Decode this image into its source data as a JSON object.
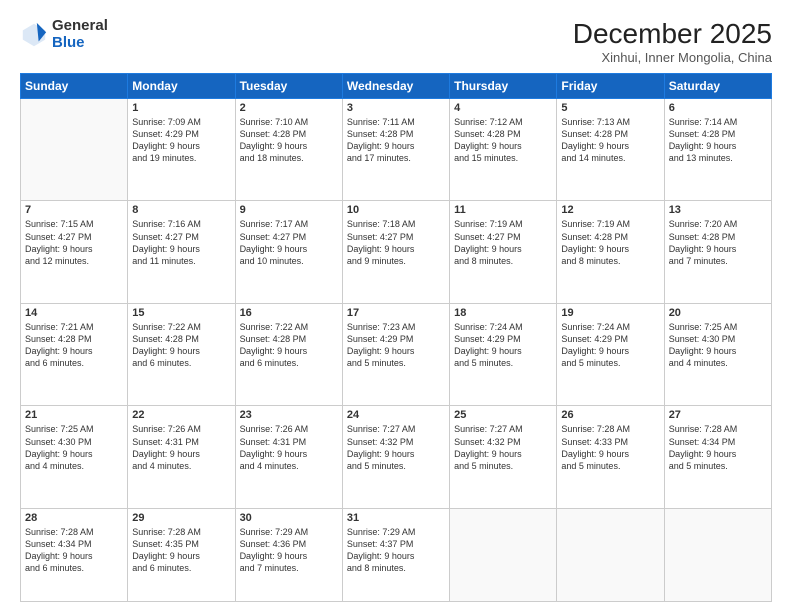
{
  "logo": {
    "general": "General",
    "blue": "Blue"
  },
  "header": {
    "month": "December 2025",
    "location": "Xinhui, Inner Mongolia, China"
  },
  "weekdays": [
    "Sunday",
    "Monday",
    "Tuesday",
    "Wednesday",
    "Thursday",
    "Friday",
    "Saturday"
  ],
  "weeks": [
    [
      {
        "day": "",
        "info": ""
      },
      {
        "day": "1",
        "info": "Sunrise: 7:09 AM\nSunset: 4:29 PM\nDaylight: 9 hours\nand 19 minutes."
      },
      {
        "day": "2",
        "info": "Sunrise: 7:10 AM\nSunset: 4:28 PM\nDaylight: 9 hours\nand 18 minutes."
      },
      {
        "day": "3",
        "info": "Sunrise: 7:11 AM\nSunset: 4:28 PM\nDaylight: 9 hours\nand 17 minutes."
      },
      {
        "day": "4",
        "info": "Sunrise: 7:12 AM\nSunset: 4:28 PM\nDaylight: 9 hours\nand 15 minutes."
      },
      {
        "day": "5",
        "info": "Sunrise: 7:13 AM\nSunset: 4:28 PM\nDaylight: 9 hours\nand 14 minutes."
      },
      {
        "day": "6",
        "info": "Sunrise: 7:14 AM\nSunset: 4:28 PM\nDaylight: 9 hours\nand 13 minutes."
      }
    ],
    [
      {
        "day": "7",
        "info": "Sunrise: 7:15 AM\nSunset: 4:27 PM\nDaylight: 9 hours\nand 12 minutes."
      },
      {
        "day": "8",
        "info": "Sunrise: 7:16 AM\nSunset: 4:27 PM\nDaylight: 9 hours\nand 11 minutes."
      },
      {
        "day": "9",
        "info": "Sunrise: 7:17 AM\nSunset: 4:27 PM\nDaylight: 9 hours\nand 10 minutes."
      },
      {
        "day": "10",
        "info": "Sunrise: 7:18 AM\nSunset: 4:27 PM\nDaylight: 9 hours\nand 9 minutes."
      },
      {
        "day": "11",
        "info": "Sunrise: 7:19 AM\nSunset: 4:27 PM\nDaylight: 9 hours\nand 8 minutes."
      },
      {
        "day": "12",
        "info": "Sunrise: 7:19 AM\nSunset: 4:28 PM\nDaylight: 9 hours\nand 8 minutes."
      },
      {
        "day": "13",
        "info": "Sunrise: 7:20 AM\nSunset: 4:28 PM\nDaylight: 9 hours\nand 7 minutes."
      }
    ],
    [
      {
        "day": "14",
        "info": "Sunrise: 7:21 AM\nSunset: 4:28 PM\nDaylight: 9 hours\nand 6 minutes."
      },
      {
        "day": "15",
        "info": "Sunrise: 7:22 AM\nSunset: 4:28 PM\nDaylight: 9 hours\nand 6 minutes."
      },
      {
        "day": "16",
        "info": "Sunrise: 7:22 AM\nSunset: 4:28 PM\nDaylight: 9 hours\nand 6 minutes."
      },
      {
        "day": "17",
        "info": "Sunrise: 7:23 AM\nSunset: 4:29 PM\nDaylight: 9 hours\nand 5 minutes."
      },
      {
        "day": "18",
        "info": "Sunrise: 7:24 AM\nSunset: 4:29 PM\nDaylight: 9 hours\nand 5 minutes."
      },
      {
        "day": "19",
        "info": "Sunrise: 7:24 AM\nSunset: 4:29 PM\nDaylight: 9 hours\nand 5 minutes."
      },
      {
        "day": "20",
        "info": "Sunrise: 7:25 AM\nSunset: 4:30 PM\nDaylight: 9 hours\nand 4 minutes."
      }
    ],
    [
      {
        "day": "21",
        "info": "Sunrise: 7:25 AM\nSunset: 4:30 PM\nDaylight: 9 hours\nand 4 minutes."
      },
      {
        "day": "22",
        "info": "Sunrise: 7:26 AM\nSunset: 4:31 PM\nDaylight: 9 hours\nand 4 minutes."
      },
      {
        "day": "23",
        "info": "Sunrise: 7:26 AM\nSunset: 4:31 PM\nDaylight: 9 hours\nand 4 minutes."
      },
      {
        "day": "24",
        "info": "Sunrise: 7:27 AM\nSunset: 4:32 PM\nDaylight: 9 hours\nand 5 minutes."
      },
      {
        "day": "25",
        "info": "Sunrise: 7:27 AM\nSunset: 4:32 PM\nDaylight: 9 hours\nand 5 minutes."
      },
      {
        "day": "26",
        "info": "Sunrise: 7:28 AM\nSunset: 4:33 PM\nDaylight: 9 hours\nand 5 minutes."
      },
      {
        "day": "27",
        "info": "Sunrise: 7:28 AM\nSunset: 4:34 PM\nDaylight: 9 hours\nand 5 minutes."
      }
    ],
    [
      {
        "day": "28",
        "info": "Sunrise: 7:28 AM\nSunset: 4:34 PM\nDaylight: 9 hours\nand 6 minutes."
      },
      {
        "day": "29",
        "info": "Sunrise: 7:28 AM\nSunset: 4:35 PM\nDaylight: 9 hours\nand 6 minutes."
      },
      {
        "day": "30",
        "info": "Sunrise: 7:29 AM\nSunset: 4:36 PM\nDaylight: 9 hours\nand 7 minutes."
      },
      {
        "day": "31",
        "info": "Sunrise: 7:29 AM\nSunset: 4:37 PM\nDaylight: 9 hours\nand 8 minutes."
      },
      {
        "day": "",
        "info": ""
      },
      {
        "day": "",
        "info": ""
      },
      {
        "day": "",
        "info": ""
      }
    ]
  ]
}
